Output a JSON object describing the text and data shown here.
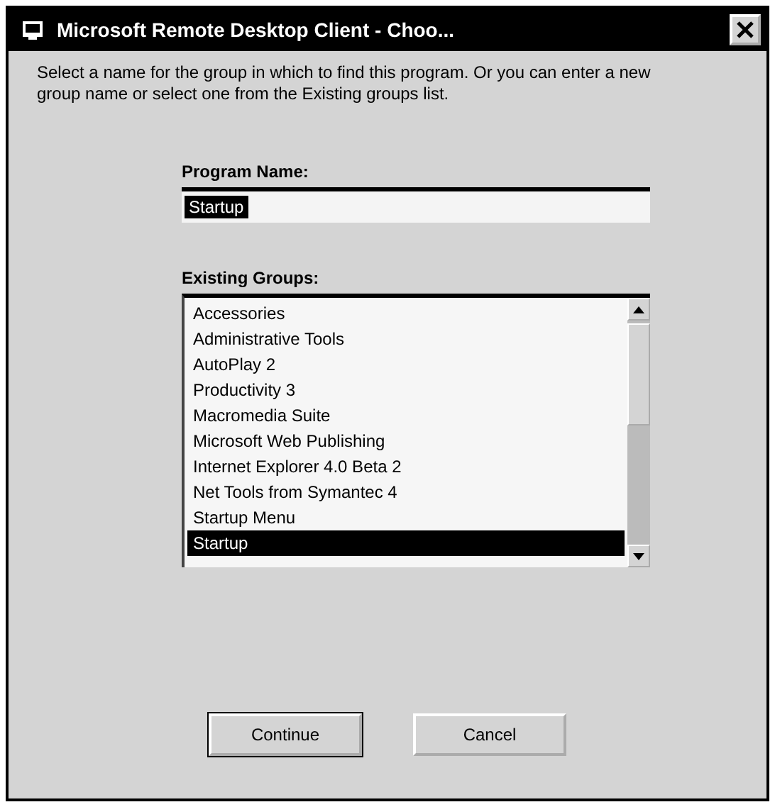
{
  "window": {
    "title": "Microsoft Remote Desktop Client - Choo..."
  },
  "instructions": "Select a name for the group in which to find this program. Or you can enter a new group name or select one from the Existing groups list.",
  "program_name": {
    "label": "Program Name:",
    "value": "Startup"
  },
  "program_group": {
    "label": "Existing Groups:",
    "items": [
      {
        "label": "Accessories",
        "selected": false
      },
      {
        "label": "Administrative Tools",
        "selected": false
      },
      {
        "label": "AutoPlay 2",
        "selected": false
      },
      {
        "label": "Productivity 3",
        "selected": false
      },
      {
        "label": "Macromedia Suite",
        "selected": false
      },
      {
        "label": "Microsoft Web Publishing",
        "selected": false
      },
      {
        "label": "Internet Explorer 4.0 Beta 2",
        "selected": false
      },
      {
        "label": "Net Tools from Symantec 4",
        "selected": false
      },
      {
        "label": "Startup Menu",
        "selected": false
      },
      {
        "label": "Startup",
        "selected": true
      }
    ]
  },
  "buttons": [
    "Continue",
    "Cancel"
  ]
}
